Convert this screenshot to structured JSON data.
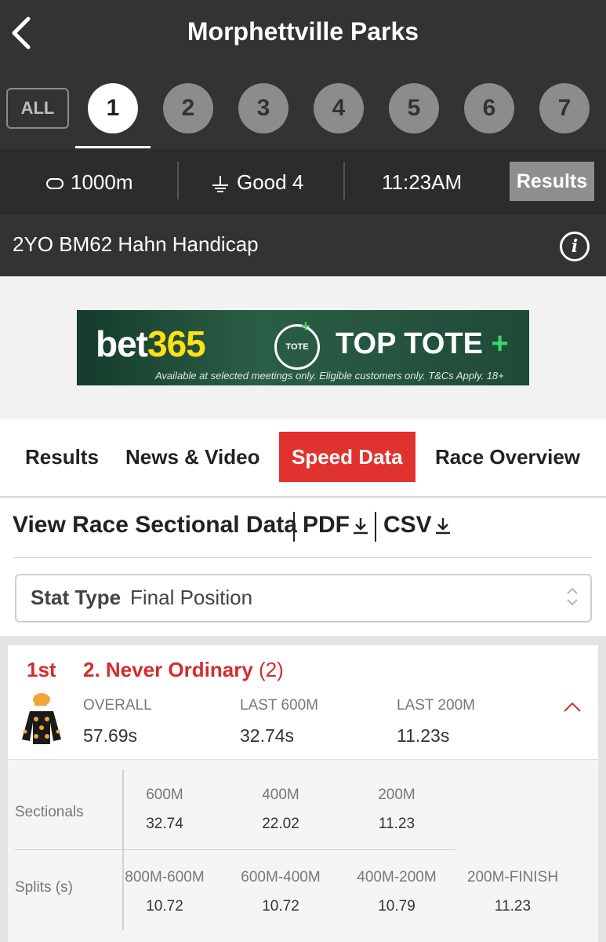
{
  "header": {
    "title": "Morphettville Parks",
    "race_tabs": {
      "all_label": "ALL",
      "numbers": [
        "1",
        "2",
        "3",
        "4",
        "5",
        "6",
        "7"
      ],
      "active": "1"
    },
    "info": {
      "distance": "1000m",
      "track": "Good 4",
      "time": "11:23AM",
      "results_label": "Results"
    },
    "race_name": "2YO BM62 Hahn Handicap"
  },
  "ad": {
    "brand_white": "bet",
    "brand_yellow": "365",
    "tote_badge": "TOTE",
    "headline": "TOP TOTE",
    "headline_plus": "+",
    "disclaimer": "Available at selected meetings only. Eligible customers only. T&Cs Apply. 18+"
  },
  "nav_tabs": [
    "Results",
    "News & Video",
    "Speed Data",
    "Race Overview"
  ],
  "active_nav_tab": "Speed Data",
  "sectional": {
    "heading": "View Race Sectional Data",
    "pdf_label": "PDF",
    "csv_label": "CSV",
    "stat_type_label": "Stat Type",
    "stat_type_value": "Final Position"
  },
  "runner": {
    "place": "1st",
    "horse_name": "2. Never Ordinary",
    "barrier": "(2)",
    "stats": [
      {
        "label": "OVERALL",
        "value": "57.69s"
      },
      {
        "label": "LAST 600M",
        "value": "32.74s"
      },
      {
        "label": "LAST 200M",
        "value": "11.23s"
      }
    ],
    "sectionals_label": "Sectionals",
    "sectionals": [
      {
        "label": "600M",
        "value": "32.74"
      },
      {
        "label": "400M",
        "value": "22.02"
      },
      {
        "label": "200M",
        "value": "11.23"
      }
    ],
    "splits_label": "Splits (s)",
    "splits": [
      {
        "label": "800M-600M",
        "value": "10.72"
      },
      {
        "label": "600M-400M",
        "value": "10.72"
      },
      {
        "label": "400M-200M",
        "value": "10.79"
      },
      {
        "label": "200M-FINISH",
        "value": "11.23"
      }
    ]
  },
  "colors": {
    "accent_red": "#e0322f",
    "header_dark": "#333333",
    "tab_grey": "#8c8c8c",
    "silks_orange": "#f2a33a"
  },
  "icons": [
    "back-arrow-icon",
    "distance-icon",
    "track-condition-icon",
    "info-icon",
    "download-icon",
    "select-chevrons-icon",
    "jockey-silks-icon",
    "collapse-chevron-icon"
  ]
}
